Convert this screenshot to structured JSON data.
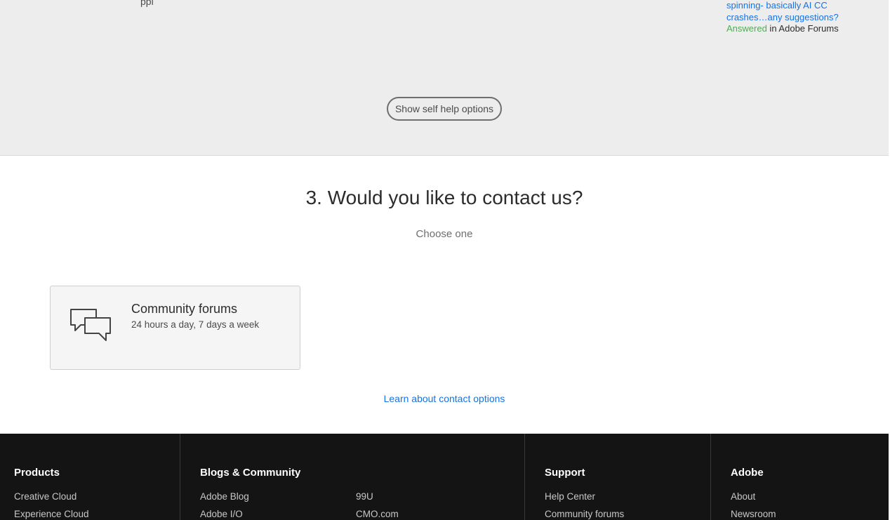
{
  "help_section": {
    "partial_left": "ppl",
    "forum_result": {
      "title_line1": "spinning- basically AI CC",
      "title_line2": "crashes…any suggestions?",
      "status": "Answered",
      "location": " in Adobe Forums"
    },
    "self_help_button": "Show self help options"
  },
  "contact": {
    "title": "3. Would you like to contact us?",
    "subtitle": "Choose one",
    "option": {
      "icon": "chat-bubbles-icon",
      "title": "Community forums",
      "description": "24 hours a day, 7 days a week"
    },
    "learn_link": "Learn about contact options"
  },
  "footer": {
    "products": {
      "heading": "Products",
      "links": [
        "Creative Cloud",
        "Experience Cloud"
      ]
    },
    "blogs": {
      "heading": "Blogs & Community",
      "links": [
        "Adobe Blog",
        "Adobe I/O",
        "99U",
        "CMO.com"
      ]
    },
    "support": {
      "heading": "Support",
      "links": [
        "Help Center",
        "Community forums"
      ]
    },
    "adobe": {
      "heading": "Adobe",
      "links": [
        "About",
        "Newsroom"
      ]
    }
  },
  "colors": {
    "link": "#1473e6",
    "answered": "#4caf50",
    "footer_bg": "#141414",
    "section_bg": "#ededed"
  }
}
